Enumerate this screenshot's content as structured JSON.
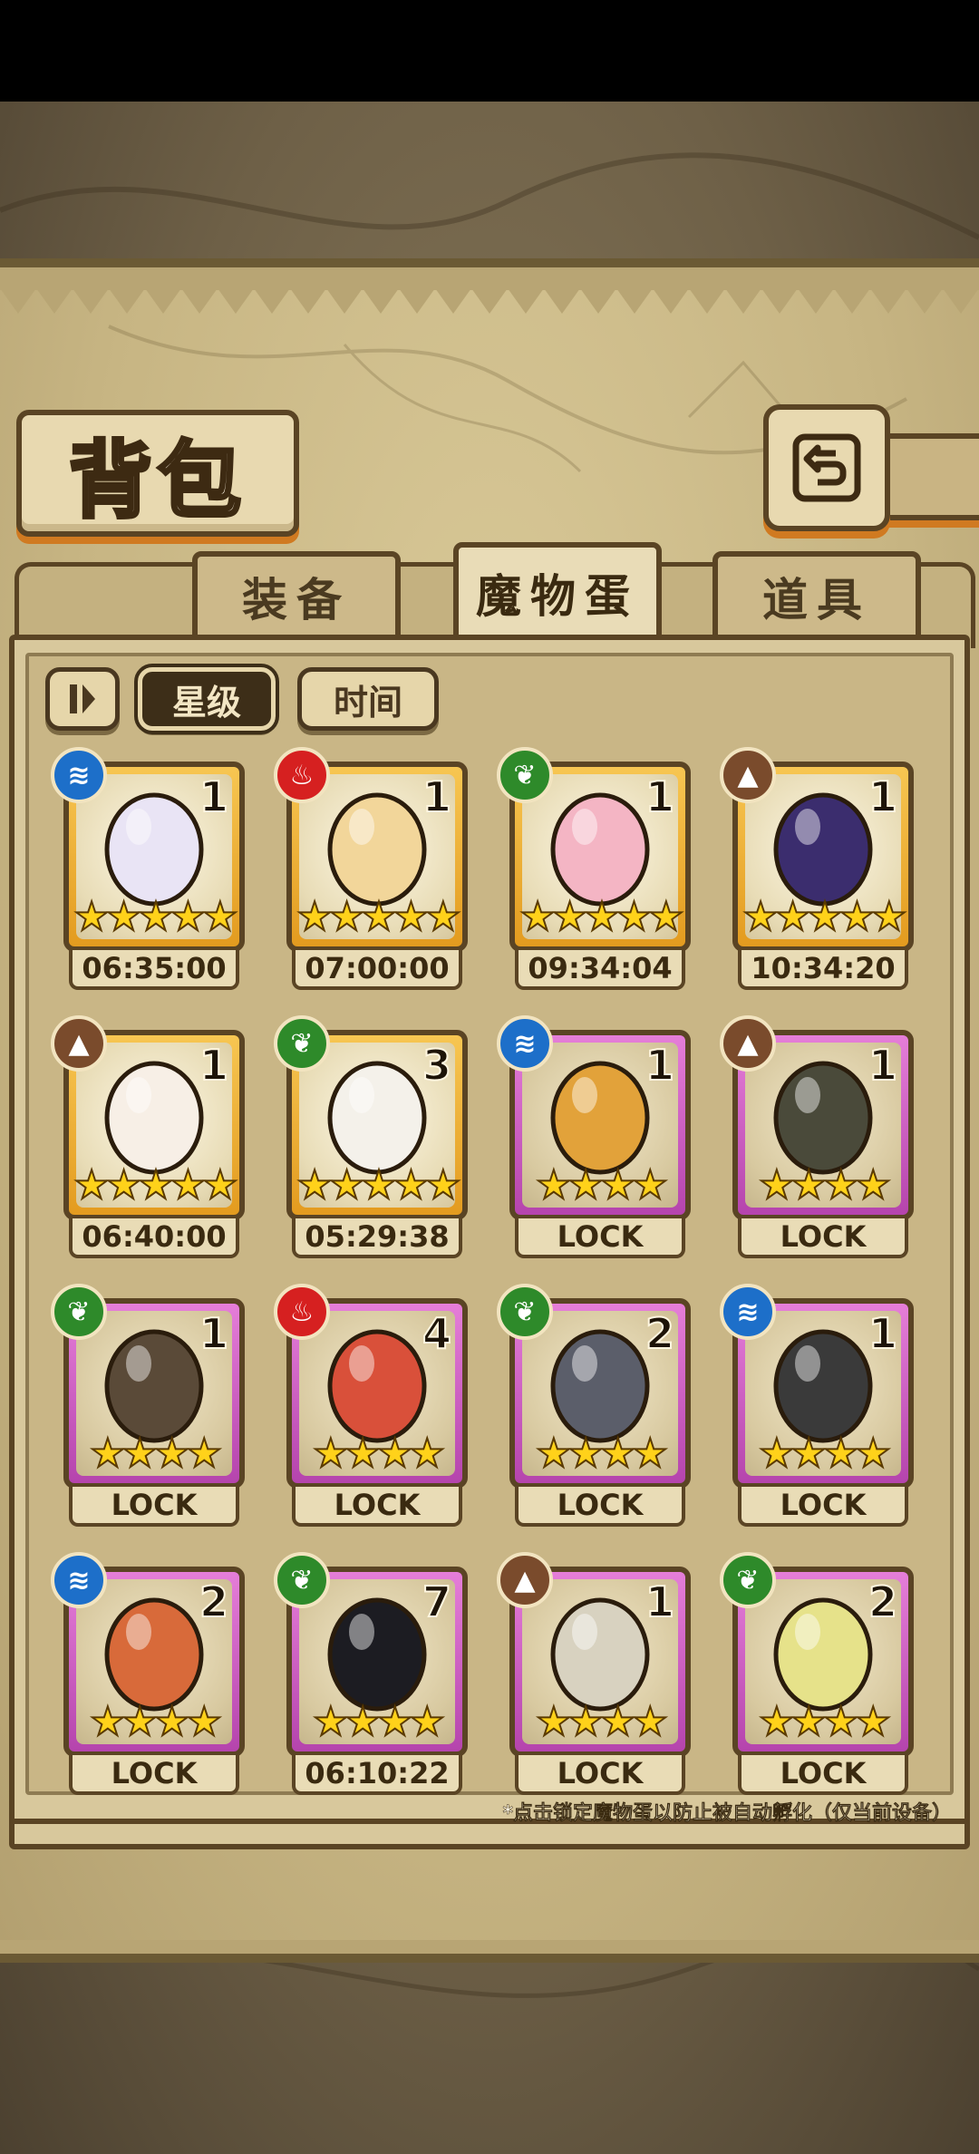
{
  "header": {
    "title": "背包"
  },
  "tabs": [
    {
      "label": "装备",
      "active": false
    },
    {
      "label": "魔物蛋",
      "active": true
    },
    {
      "label": "道具",
      "active": false
    }
  ],
  "filters": [
    {
      "label": "星级",
      "active": true
    },
    {
      "label": "时间",
      "active": false
    }
  ],
  "eggs": [
    {
      "element": "water",
      "count": "1",
      "stars": 5,
      "rarity": "gold",
      "status": "06:35:00",
      "egg_color": "#e9e4f5"
    },
    {
      "element": "fire",
      "count": "1",
      "stars": 5,
      "rarity": "gold",
      "status": "07:00:00",
      "egg_color": "#f2d69a"
    },
    {
      "element": "grass",
      "count": "1",
      "stars": 5,
      "rarity": "gold",
      "status": "09:34:04",
      "egg_color": "#f4b5c4"
    },
    {
      "element": "earth",
      "count": "1",
      "stars": 5,
      "rarity": "gold",
      "status": "10:34:20",
      "egg_color": "#3b2d6e"
    },
    {
      "element": "earth",
      "count": "1",
      "stars": 5,
      "rarity": "gold",
      "status": "06:40:00",
      "egg_color": "#f7efe6"
    },
    {
      "element": "grass",
      "count": "3",
      "stars": 5,
      "rarity": "gold",
      "status": "05:29:38",
      "egg_color": "#f4f1ea"
    },
    {
      "element": "water",
      "count": "1",
      "stars": 4,
      "rarity": "purple",
      "status": "LOCK",
      "egg_color": "#e2a23a"
    },
    {
      "element": "earth",
      "count": "1",
      "stars": 4,
      "rarity": "purple",
      "status": "LOCK",
      "egg_color": "#4a4a3a"
    },
    {
      "element": "grass",
      "count": "1",
      "stars": 4,
      "rarity": "purple",
      "status": "LOCK",
      "egg_color": "#5a4a38"
    },
    {
      "element": "fire",
      "count": "4",
      "stars": 4,
      "rarity": "purple",
      "status": "LOCK",
      "egg_color": "#d9503a"
    },
    {
      "element": "grass",
      "count": "2",
      "stars": 4,
      "rarity": "purple",
      "status": "LOCK",
      "egg_color": "#5b5e6a"
    },
    {
      "element": "water",
      "count": "1",
      "stars": 4,
      "rarity": "purple",
      "status": "LOCK",
      "egg_color": "#3a3a3a"
    },
    {
      "element": "water",
      "count": "2",
      "stars": 4,
      "rarity": "purple",
      "status": "LOCK",
      "egg_color": "#d86a3a"
    },
    {
      "element": "grass",
      "count": "7",
      "stars": 4,
      "rarity": "purple",
      "status": "06:10:22",
      "egg_color": "#1c1c22"
    },
    {
      "element": "earth",
      "count": "1",
      "stars": 4,
      "rarity": "purple",
      "status": "LOCK",
      "egg_color": "#d8d2c0"
    },
    {
      "element": "grass",
      "count": "2",
      "stars": 4,
      "rarity": "purple",
      "status": "LOCK",
      "egg_color": "#e6e28a"
    }
  ],
  "note": "*点击锁定魔物蛋以防止被自动孵化（仅当前设备）"
}
